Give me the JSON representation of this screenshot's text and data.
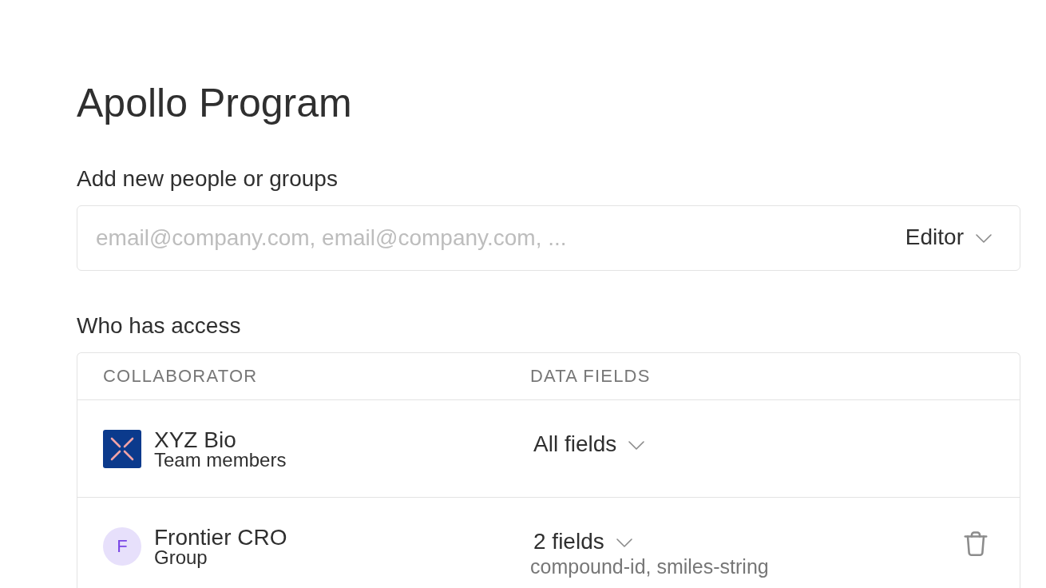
{
  "page": {
    "title": "Apollo Program"
  },
  "invite": {
    "label": "Add new people or groups",
    "placeholder": "email@company.com, email@company.com, ...",
    "role": "Editor"
  },
  "access": {
    "label": "Who has access",
    "columns": [
      "COLLABORATOR",
      "DATA FIELDS"
    ],
    "rows": [
      {
        "kind": "organization",
        "name": "XYZ Bio",
        "subtitle": "Team members",
        "fields": "All fields",
        "removable": false
      },
      {
        "kind": "group",
        "avatar": "F",
        "name": "Frontier CRO",
        "subtitle": "Group",
        "fields": "2 fields",
        "field_list": "compound-id, smiles-string",
        "removable": true
      }
    ]
  }
}
